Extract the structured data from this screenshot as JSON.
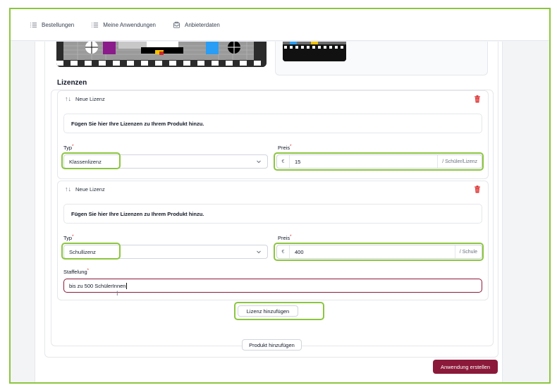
{
  "nav": {
    "items": [
      {
        "label": "Bestellungen",
        "icon": "list-icon"
      },
      {
        "label": "Meine Anwendungen",
        "icon": "list-icon"
      },
      {
        "label": "Anbieterdaten",
        "icon": "inbox-icon"
      }
    ]
  },
  "section": {
    "title": "Lizenzen"
  },
  "licenses": [
    {
      "header": "Neue Lizenz",
      "hint": "Fügen Sie hier Ihre Lizenzen zu Ihrem Produkt hinzu.",
      "type_label": "Typ",
      "type_value": "Klassenlizenz",
      "price_label": "Preis",
      "currency": "€",
      "price_value": "15",
      "unit": "/ Schüler/Lizenz"
    },
    {
      "header": "Neue Lizenz",
      "hint": "Fügen Sie hier Ihre Lizenzen zu Ihrem Produkt hinzu.",
      "type_label": "Typ",
      "type_value": "Schullizenz",
      "price_label": "Preis",
      "currency": "€",
      "price_value": "400",
      "unit": "/ Schule",
      "staffelung_label": "Staffelung",
      "staffelung_value": "bis zu 500 SchülerInnen"
    }
  ],
  "required_mark": "*",
  "buttons": {
    "add_license": "Lizenz hinzufügen",
    "add_product": "Produkt hinzufügen",
    "create_app": "Anwendung erstellen"
  },
  "colors": {
    "highlight": "#8cc63f",
    "primary": "#8b1a3a",
    "danger": "#dc2626"
  }
}
